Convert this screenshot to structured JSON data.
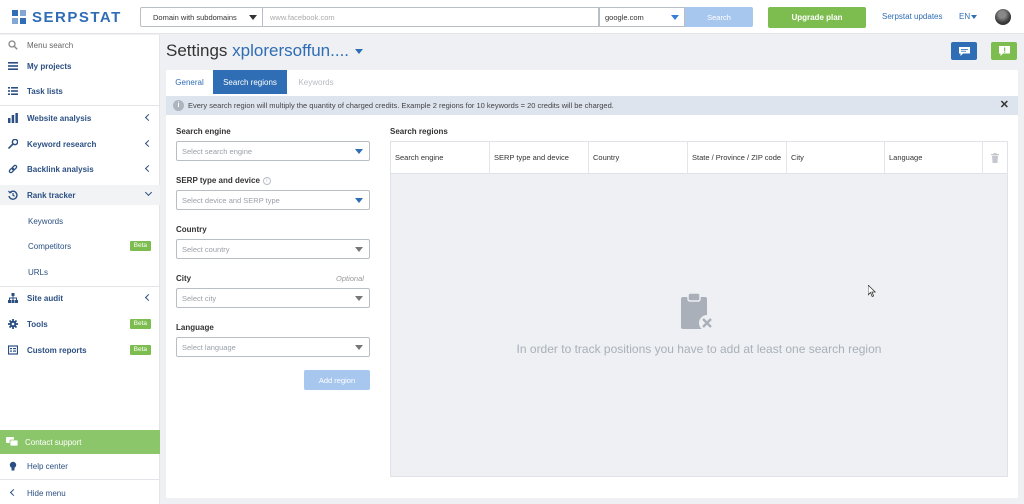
{
  "brand": {
    "logo_text": "SERPSTAT",
    "accent": "#2f6db5",
    "green": "#7dbd4f"
  },
  "topbar": {
    "search_type": "Domain with subdomains",
    "search_placeholder": "www.facebook.com",
    "engine": "google.com",
    "search_button": "Search",
    "upgrade_button": "Upgrade plan",
    "updates_link": "Serpstat updates",
    "language": "EN"
  },
  "sidebar": {
    "menu_search": "Menu search",
    "items": [
      {
        "label": "My projects",
        "icon": "list-icon"
      },
      {
        "label": "Task lists",
        "icon": "checklist-icon"
      },
      {
        "label": "Website analysis",
        "icon": "chart-icon"
      },
      {
        "label": "Keyword research",
        "icon": "key-icon"
      },
      {
        "label": "Backlink analysis",
        "icon": "link-icon"
      },
      {
        "label": "Rank tracker",
        "icon": "history-icon"
      }
    ],
    "sub_items": [
      {
        "label": "Keywords"
      },
      {
        "label": "Competitors",
        "badge": "Beta"
      },
      {
        "label": "URLs"
      }
    ],
    "tools": [
      {
        "label": "Site audit",
        "icon": "sitemap-icon"
      },
      {
        "label": "Tools",
        "icon": "gear-icon",
        "badge": "Beta"
      },
      {
        "label": "Custom reports",
        "icon": "report-icon",
        "badge": "Beta"
      }
    ],
    "contact_support": "Contact support",
    "help_center": "Help center",
    "hide_menu": "Hide menu"
  },
  "page": {
    "title": "Settings",
    "project": "xplorersoffun...."
  },
  "tabs": [
    {
      "label": "General",
      "state": "link"
    },
    {
      "label": "Search regions",
      "state": "active"
    },
    {
      "label": "Keywords",
      "state": "disabled"
    }
  ],
  "notice": {
    "text": "Every search region will multiply the quantity of charged credits. Example 2 regions for 10 keywords = 20 credits will be charged."
  },
  "form": {
    "search_engine": {
      "label": "Search engine",
      "placeholder": "Select search engine"
    },
    "serp_type": {
      "label": "SERP type and device",
      "placeholder": "Select device and SERP type"
    },
    "country": {
      "label": "Country",
      "placeholder": "Select country"
    },
    "city": {
      "label": "City",
      "optional": "Optional",
      "placeholder": "Select city"
    },
    "language": {
      "label": "Language",
      "placeholder": "Select language"
    },
    "add_button": "Add region"
  },
  "regions": {
    "title": "Search regions",
    "columns": [
      "Search engine",
      "SERP type and device",
      "Country",
      "State / Province / ZIP code",
      "City",
      "Language"
    ],
    "empty_text": "In order to track positions you have to add at least one search region"
  }
}
